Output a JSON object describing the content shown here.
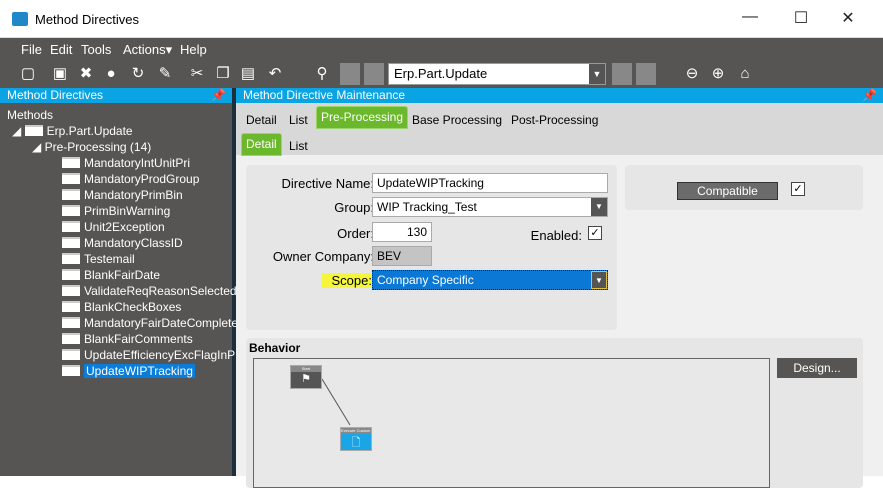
{
  "window": {
    "title": "Method Directives",
    "minimize": "—",
    "maximize": "☐",
    "close": "✕"
  },
  "menu": [
    "File",
    "Edit",
    "Tools",
    "Actions▾",
    "Help"
  ],
  "toolbar": {
    "search_value": "Erp.Part.Update"
  },
  "left_panel": {
    "title": "Method Directives",
    "root": "Methods",
    "method": "Erp.Part.Update",
    "group": "Pre-Processing (14)",
    "items": [
      "MandatoryIntUnitPri",
      "MandatoryProdGroup",
      "MandatoryPrimBin",
      "PrimBinWarning",
      "Unit2Exception",
      "MandatoryClassID",
      "Testemail",
      "BlankFairDate",
      "ValidateReqReasonSelected",
      "BlankCheckBoxes",
      "MandatoryFairDateComplete",
      "BlankFairComments",
      "UpdateEfficiencyExcFlagInP",
      "UpdateWIPTracking"
    ],
    "selected_index": 13
  },
  "right_panel": {
    "title": "Method Directive Maintenance",
    "tabs": [
      "Detail",
      "List",
      "Pre-Processing",
      "Base Processing",
      "Post-Processing"
    ],
    "subtabs": [
      "Detail",
      "List"
    ],
    "form": {
      "directive_name_label": "Directive Name:",
      "directive_name": "UpdateWIPTracking",
      "group_label": "Group:",
      "group": "WIP Tracking_Test",
      "order_label": "Order:",
      "order": "130",
      "enabled_label": "Enabled:",
      "enabled": true,
      "owner_label": "Owner Company:",
      "owner": "BEV",
      "scope_label": "Scope:",
      "scope": "Company Specific"
    },
    "compatible_label": "Compatible",
    "compatible": true,
    "behavior_label": "Behavior",
    "design_label": "Design...",
    "nodes": {
      "start": "Start",
      "action": "Execute Custom Code"
    }
  },
  "colors": {
    "accent": "#0aa4e4",
    "tab_active": "#6bb82c",
    "highlight": "#f5f53c"
  }
}
